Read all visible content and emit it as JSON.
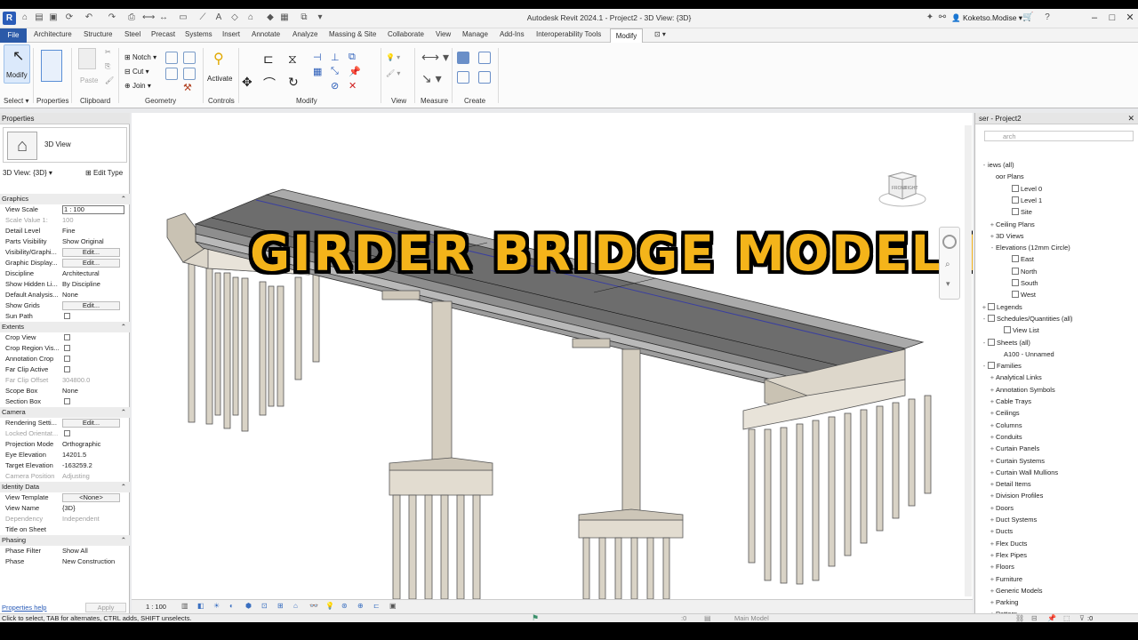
{
  "titlebar": {
    "app_title": "Autodesk Revit 2024.1 - Project2 - 3D View: {3D}",
    "app_logo": "R",
    "user": "Koketso.Modise",
    "icons": [
      "open-icon",
      "save-icon",
      "undo-icon",
      "redo-icon",
      "print-icon",
      "measure-icon",
      "text-icon",
      "home-icon",
      "switch-windows-icon",
      "cart-icon",
      "help-icon"
    ]
  },
  "tabs": [
    "Architecture",
    "Structure",
    "Steel",
    "Precast",
    "Systems",
    "Insert",
    "Annotate",
    "Analyze",
    "Massing & Site",
    "Collaborate",
    "View",
    "Manage",
    "Add-Ins",
    "Interoperability Tools"
  ],
  "tab_file": "File",
  "tab_modify": "Modify",
  "ribbon": {
    "modify_label": "Modify",
    "paste_label": "Paste",
    "notch_label": "Notch",
    "cut_label": "Cut",
    "join_label": "Join",
    "activate_label": "Activate",
    "panels": {
      "select": "Select",
      "properties": "Properties",
      "clipboard": "Clipboard",
      "geometry": "Geometry",
      "controls": "Controls",
      "modify": "Modify",
      "view": "View",
      "measure": "Measure",
      "create": "Create"
    }
  },
  "properties": {
    "header": "Properties",
    "type_name": "3D View",
    "view_selector": "3D View: {3D}",
    "edit_type": "Edit Type",
    "groups": {
      "graphics": "Graphics",
      "extents": "Extents",
      "camera": "Camera",
      "identity": "Identity Data",
      "phasing": "Phasing"
    },
    "rows": {
      "view_scale_k": "View Scale",
      "view_scale_v": "1 : 100",
      "scale_value_k": "Scale Value    1:",
      "scale_value_v": "100",
      "detail_level_k": "Detail Level",
      "detail_level_v": "Fine",
      "parts_vis_k": "Parts Visibility",
      "parts_vis_v": "Show Original",
      "vis_graphics_k": "Visibility/Graphi...",
      "graphic_display_k": "Graphic Display...",
      "discipline_k": "Discipline",
      "discipline_v": "Architectural",
      "show_hidden_k": "Show Hidden Li...",
      "show_hidden_v": "By Discipline",
      "default_analysis_k": "Default Analysis...",
      "default_analysis_v": "None",
      "show_grids_k": "Show Grids",
      "sun_path_k": "Sun Path",
      "crop_view_k": "Crop View",
      "crop_region_k": "Crop Region Vis...",
      "annotation_crop_k": "Annotation Crop",
      "far_clip_active_k": "Far Clip Active",
      "far_clip_offset_k": "Far Clip Offset",
      "far_clip_offset_v": "304800.0",
      "scope_box_k": "Scope Box",
      "scope_box_v": "None",
      "section_box_k": "Section Box",
      "rendering_k": "Rendering Setti...",
      "locked_orient_k": "Locked Orientat...",
      "projection_k": "Projection Mode",
      "projection_v": "Orthographic",
      "eye_elev_k": "Eye Elevation",
      "eye_elev_v": "14201.5",
      "target_elev_k": "Target Elevation",
      "target_elev_v": "-163259.2",
      "camera_pos_k": "Camera Position",
      "camera_pos_v": "Adjusting",
      "view_template_k": "View Template",
      "view_template_v": "<None>",
      "view_name_k": "View Name",
      "view_name_v": "{3D}",
      "dependency_k": "Dependency",
      "dependency_v": "Independent",
      "title_on_sheet_k": "Title on Sheet",
      "phase_filter_k": "Phase Filter",
      "phase_filter_v": "Show All",
      "phase_k": "Phase",
      "phase_v": "New Construction"
    },
    "edit_btn": "Edit...",
    "help_link": "Properties help",
    "apply": "Apply"
  },
  "viewport": {
    "headline": "GIRDER BRIDGE MODEL IN REVIT",
    "viewcube_front": "FRONT",
    "viewcube_right": "RIGHT",
    "scale": "1 : 100"
  },
  "browser": {
    "header": "ser - Project2",
    "search_placeholder": "arch",
    "tree": [
      {
        "label": "iews (all)",
        "indent": 0,
        "exp": "-"
      },
      {
        "label": "oor Plans",
        "indent": 1,
        "exp": ""
      },
      {
        "label": "Level 0",
        "indent": 3,
        "exp": "",
        "icon": true
      },
      {
        "label": "Level 1",
        "indent": 3,
        "exp": "",
        "icon": true
      },
      {
        "label": "Site",
        "indent": 3,
        "exp": "",
        "icon": true
      },
      {
        "label": "Ceiling Plans",
        "indent": 1,
        "exp": "+"
      },
      {
        "label": "3D Views",
        "indent": 1,
        "exp": "+"
      },
      {
        "label": "Elevations (12mm Circle)",
        "indent": 1,
        "exp": "-"
      },
      {
        "label": "East",
        "indent": 3,
        "exp": "",
        "icon": true
      },
      {
        "label": "North",
        "indent": 3,
        "exp": "",
        "icon": true
      },
      {
        "label": "South",
        "indent": 3,
        "exp": "",
        "icon": true
      },
      {
        "label": "West",
        "indent": 3,
        "exp": "",
        "icon": true
      },
      {
        "label": "Legends",
        "indent": 0,
        "exp": "+",
        "icon": true
      },
      {
        "label": "Schedules/Quantities (all)",
        "indent": 0,
        "exp": "-",
        "icon": true
      },
      {
        "label": "View List",
        "indent": 2,
        "exp": "",
        "icon": true
      },
      {
        "label": "Sheets (all)",
        "indent": 0,
        "exp": "-",
        "icon": true
      },
      {
        "label": "A100 - Unnamed",
        "indent": 2,
        "exp": ""
      },
      {
        "label": "Families",
        "indent": 0,
        "exp": "-",
        "icon": true
      },
      {
        "label": "Analytical Links",
        "indent": 1,
        "exp": "+"
      },
      {
        "label": "Annotation Symbols",
        "indent": 1,
        "exp": "+"
      },
      {
        "label": "Cable Trays",
        "indent": 1,
        "exp": "+"
      },
      {
        "label": "Ceilings",
        "indent": 1,
        "exp": "+"
      },
      {
        "label": "Columns",
        "indent": 1,
        "exp": "+"
      },
      {
        "label": "Conduits",
        "indent": 1,
        "exp": "+"
      },
      {
        "label": "Curtain Panels",
        "indent": 1,
        "exp": "+"
      },
      {
        "label": "Curtain Systems",
        "indent": 1,
        "exp": "+"
      },
      {
        "label": "Curtain Wall Mullions",
        "indent": 1,
        "exp": "+"
      },
      {
        "label": "Detail Items",
        "indent": 1,
        "exp": "+"
      },
      {
        "label": "Division Profiles",
        "indent": 1,
        "exp": "+"
      },
      {
        "label": "Doors",
        "indent": 1,
        "exp": "+"
      },
      {
        "label": "Duct Systems",
        "indent": 1,
        "exp": "+"
      },
      {
        "label": "Ducts",
        "indent": 1,
        "exp": "+"
      },
      {
        "label": "Flex Ducts",
        "indent": 1,
        "exp": "+"
      },
      {
        "label": "Flex Pipes",
        "indent": 1,
        "exp": "+"
      },
      {
        "label": "Floors",
        "indent": 1,
        "exp": "+"
      },
      {
        "label": "Furniture",
        "indent": 1,
        "exp": "+"
      },
      {
        "label": "Generic Models",
        "indent": 1,
        "exp": "+"
      },
      {
        "label": "Parking",
        "indent": 1,
        "exp": "+"
      },
      {
        "label": "Pattern",
        "indent": 1,
        "exp": "+"
      }
    ]
  },
  "status": {
    "hint": "Click to select, TAB for alternates, CTRL adds, SHIFT unselects.",
    "value": ":0",
    "model": "Main Model",
    "filter": ":0"
  },
  "colors": {
    "accent": "#2b5aa8",
    "headline": "#f4b41a",
    "concrete": "#d8d2c6",
    "deck": "#6d6d6d"
  }
}
